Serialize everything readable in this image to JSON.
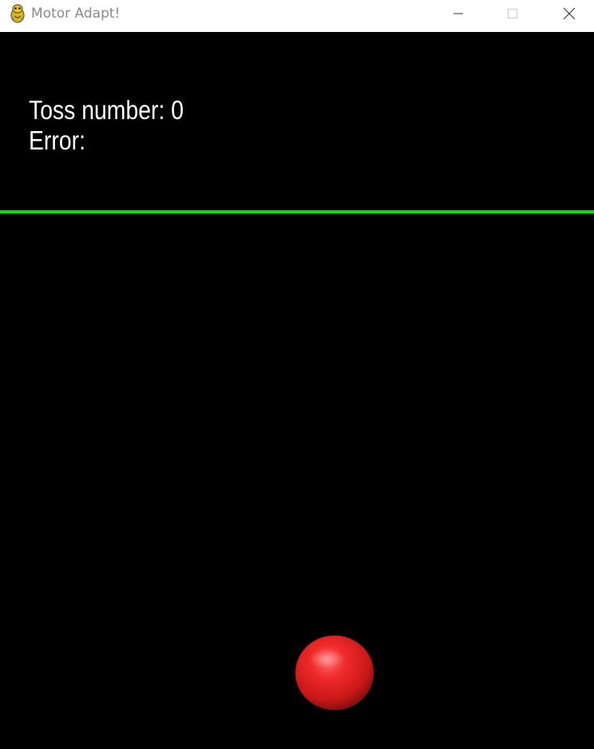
{
  "window": {
    "title": "Motor Adapt!",
    "icon": "pygame-snake-icon"
  },
  "controls": {
    "minimize_icon": "minimize-icon",
    "maximize_icon": "maximize-icon",
    "close_icon": "close-icon"
  },
  "hud": {
    "toss_label": "Toss number: 0",
    "error_label": "Error:"
  },
  "scene": {
    "line_color": "#00e600",
    "ball_color": "#e02020"
  }
}
